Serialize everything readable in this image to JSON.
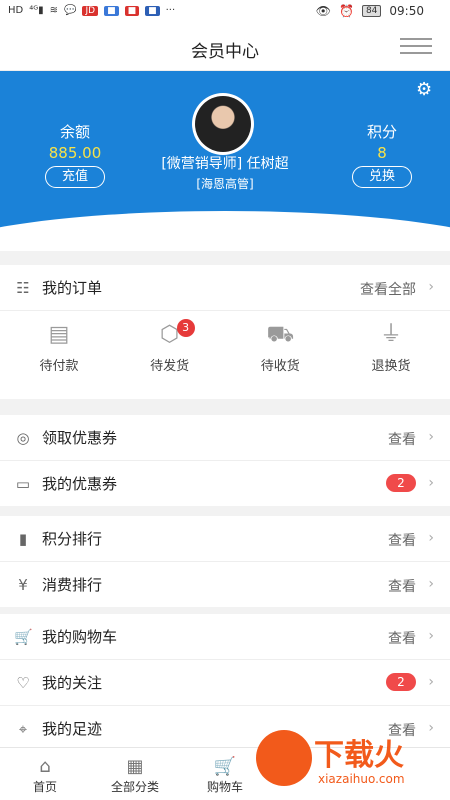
{
  "status_bar": {
    "icons_left": [
      "HD",
      "4G",
      "signal",
      "wifi",
      "wechat",
      "jd",
      "app",
      "app",
      "app",
      "more"
    ],
    "time": "09:50",
    "battery": "84"
  },
  "header": {
    "title": "会员中心"
  },
  "profile": {
    "balance_label": "余额",
    "balance_value": "885.00",
    "recharge_button": "充值",
    "points_label": "积分",
    "points_value": "8",
    "exchange_button": "兑换",
    "name": "[微营销导师] 任树超",
    "role": "[海恩高管]"
  },
  "orders": {
    "title": "我的订单",
    "view_all": "查看全部",
    "items": [
      {
        "label": "待付款",
        "icon": "wallet-icon"
      },
      {
        "label": "待发货",
        "icon": "box-icon",
        "badge": "3"
      },
      {
        "label": "待收货",
        "icon": "truck-icon"
      },
      {
        "label": "退换货",
        "icon": "plug-icon"
      }
    ]
  },
  "coupons": [
    {
      "label": "领取优惠券",
      "action": "查看",
      "icon": "coupon-icon"
    },
    {
      "label": "我的优惠券",
      "badge": "2",
      "icon": "card-icon"
    }
  ],
  "rankings": [
    {
      "label": "积分排行",
      "action": "查看",
      "icon": "bar-chart-icon"
    },
    {
      "label": "消费排行",
      "action": "查看",
      "icon": "yen-icon"
    }
  ],
  "personal": [
    {
      "label": "我的购物车",
      "action": "查看",
      "icon": "cart-icon"
    },
    {
      "label": "我的关注",
      "badge": "2",
      "icon": "heart-icon"
    },
    {
      "label": "我的足迹",
      "action": "查看",
      "icon": "footprint-icon"
    }
  ],
  "tabbar": [
    {
      "label": "首页",
      "icon": "home-icon"
    },
    {
      "label": "全部分类",
      "icon": "category-icon"
    },
    {
      "label": "购物车",
      "icon": "cart-icon"
    }
  ],
  "watermark": {
    "text": "下载火",
    "domain": "xiazaihuo.com"
  },
  "colors": {
    "banner": "#1b82d8",
    "accent_yellow": "#f7e24a",
    "badge_red": "#f04a4a"
  }
}
